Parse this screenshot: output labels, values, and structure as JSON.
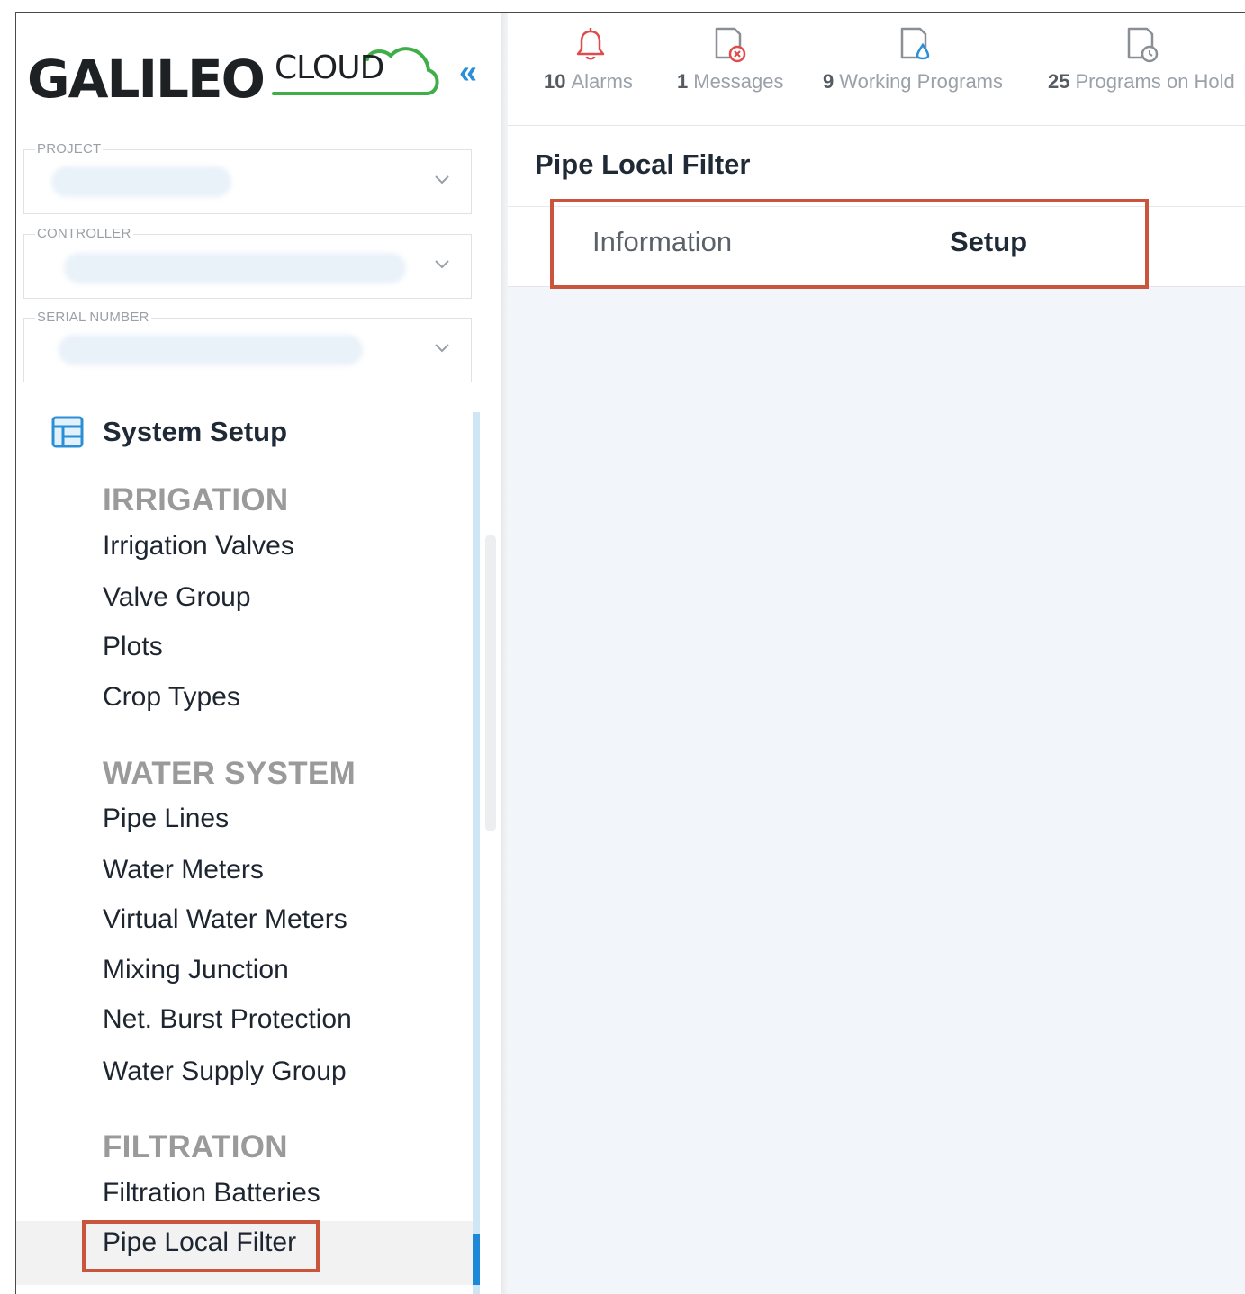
{
  "logo": {
    "main": "GALILEO",
    "suffix": "CLOUD"
  },
  "sidebar": {
    "collapse_label": "«",
    "fields": [
      {
        "label": "PROJECT"
      },
      {
        "label": "CONTROLLER"
      },
      {
        "label": "SERIAL NUMBER"
      }
    ],
    "system_setup": "System Setup",
    "sections": [
      {
        "title": "IRRIGATION",
        "items": [
          "Irrigation Valves",
          "Valve Group",
          "Plots",
          "Crop Types"
        ]
      },
      {
        "title": "WATER SYSTEM",
        "items": [
          "Pipe Lines",
          "Water Meters",
          "Virtual Water Meters",
          "Mixing Junction",
          "Net. Burst Protection",
          "Water Supply Group"
        ]
      },
      {
        "title": "FILTRATION",
        "items": [
          "Filtration Batteries",
          "Pipe Local Filter"
        ]
      }
    ],
    "active_item": "Pipe Local Filter"
  },
  "topbar": {
    "stats": [
      {
        "count": "10",
        "label": "Alarms",
        "icon": "bell-icon",
        "color": "#e04b4b"
      },
      {
        "count": "1",
        "label": "Messages",
        "icon": "message-error-icon",
        "color": "#e04b4b"
      },
      {
        "count": "9",
        "label": "Working Programs",
        "icon": "program-water-icon",
        "color": "#2a8fd6"
      },
      {
        "count": "25",
        "label": "Programs on Hold",
        "icon": "program-clock-icon",
        "color": "#8a8f94"
      }
    ]
  },
  "content": {
    "title": "Pipe Local Filter",
    "tabs": [
      "Information",
      "Setup"
    ],
    "active_tab": "Setup"
  },
  "colors": {
    "accent": "#2a8fd6",
    "callout": "#c9563c",
    "logo_green": "#3fae49"
  }
}
